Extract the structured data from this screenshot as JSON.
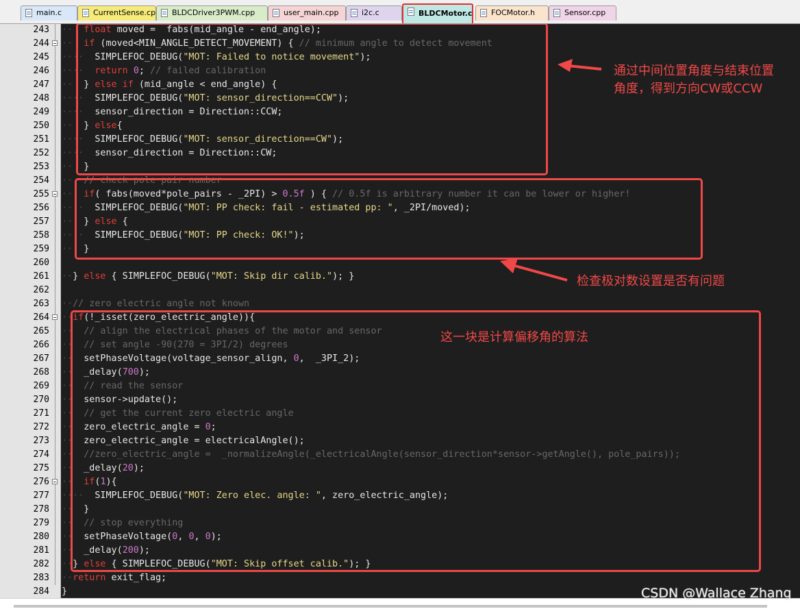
{
  "tabs": [
    {
      "label": "main.c",
      "color": "#d8e8f8",
      "active": false
    },
    {
      "label": "CurrentSense.cpp",
      "color": "#f6eb7a",
      "active": false
    },
    {
      "label": "BLDCDriver3PWM.cpp",
      "color": "#d8ecc8",
      "active": false
    },
    {
      "label": "user_main.cpp",
      "color": "#f4d4d4",
      "active": false
    },
    {
      "label": "i2c.c",
      "color": "#ded4ee",
      "active": false
    },
    {
      "label": "BLDCMotor.cpp",
      "color": "#bfe8e4",
      "active": true
    },
    {
      "label": "FOCMotor.h",
      "color": "#fbe4cc",
      "active": false
    },
    {
      "label": "Sensor.cpp",
      "color": "#f0d4e8",
      "active": false
    }
  ],
  "code_lines": [
    {
      "n": "243",
      "fold": "line",
      "tokens": [
        [
          "ws",
          "··"
        ],
        [
          "sym",
          "  "
        ],
        [
          "kw",
          "float"
        ],
        [
          "sym",
          " moved "
        ],
        [
          "sym",
          "="
        ],
        [
          "sym",
          "  fabs(mid_angle "
        ],
        [
          "sym",
          "-"
        ],
        [
          "sym",
          " end_angle);"
        ]
      ]
    },
    {
      "n": "244",
      "fold": "box",
      "tokens": [
        [
          "ws",
          "··"
        ],
        [
          "sym",
          "  "
        ],
        [
          "kw",
          "if"
        ],
        [
          "sym",
          " (moved<MIN_ANGLE_DETECT_MOVEMENT) { "
        ],
        [
          "cmt",
          "// minimum angle to detect movement"
        ]
      ]
    },
    {
      "n": "245",
      "fold": "line",
      "tokens": [
        [
          "ws",
          "····"
        ],
        [
          "sym",
          "  SIMPLEFOC_DEBUG("
        ],
        [
          "str",
          "\"MOT: Failed to notice movement\""
        ],
        [
          "sym",
          ");"
        ]
      ]
    },
    {
      "n": "246",
      "fold": "line",
      "tokens": [
        [
          "ws",
          "····"
        ],
        [
          "sym",
          "  "
        ],
        [
          "kw",
          "return"
        ],
        [
          "sym",
          " "
        ],
        [
          "num",
          "0"
        ],
        [
          "sym",
          "; "
        ],
        [
          "cmt",
          "// failed calibration"
        ]
      ]
    },
    {
      "n": "247",
      "fold": "line",
      "tokens": [
        [
          "ws",
          "··"
        ],
        [
          "sym",
          "  } "
        ],
        [
          "kw",
          "else if"
        ],
        [
          "sym",
          " (mid_angle < end_angle) {"
        ]
      ]
    },
    {
      "n": "248",
      "fold": "line",
      "tokens": [
        [
          "ws",
          "····"
        ],
        [
          "sym",
          "  SIMPLEFOC_DEBUG("
        ],
        [
          "str",
          "\"MOT: sensor_direction==CCW\""
        ],
        [
          "sym",
          ");"
        ]
      ]
    },
    {
      "n": "249",
      "fold": "line",
      "tokens": [
        [
          "ws",
          "····"
        ],
        [
          "sym",
          "  sensor_direction = Direction::CCW;"
        ]
      ]
    },
    {
      "n": "250",
      "fold": "line",
      "tokens": [
        [
          "ws",
          "··"
        ],
        [
          "sym",
          "  } "
        ],
        [
          "kw",
          "else"
        ],
        [
          "sym",
          "{"
        ]
      ]
    },
    {
      "n": "251",
      "fold": "line",
      "tokens": [
        [
          "ws",
          "····"
        ],
        [
          "sym",
          "  SIMPLEFOC_DEBUG("
        ],
        [
          "str",
          "\"MOT: sensor_direction==CW\""
        ],
        [
          "sym",
          ");"
        ]
      ]
    },
    {
      "n": "252",
      "fold": "line",
      "tokens": [
        [
          "ws",
          "····"
        ],
        [
          "sym",
          "  sensor_direction = Direction::CW;"
        ]
      ]
    },
    {
      "n": "253",
      "fold": "line",
      "tokens": [
        [
          "ws",
          "··"
        ],
        [
          "sym",
          "  }"
        ]
      ]
    },
    {
      "n": "254",
      "fold": "line",
      "tokens": [
        [
          "ws",
          "··"
        ],
        [
          "sym",
          "  "
        ],
        [
          "cmt",
          "// check pole pair number"
        ]
      ]
    },
    {
      "n": "255",
      "fold": "box",
      "tokens": [
        [
          "ws",
          "··"
        ],
        [
          "sym",
          "  "
        ],
        [
          "kw",
          "if"
        ],
        [
          "sym",
          "( fabs(moved*pole_pairs "
        ],
        [
          "sym",
          "-"
        ],
        [
          "sym",
          " _2PI) > "
        ],
        [
          "num",
          "0.5f"
        ],
        [
          "sym",
          " ) { "
        ],
        [
          "cmt",
          "// 0.5f is arbitrary number it can be lower or higher!"
        ]
      ]
    },
    {
      "n": "256",
      "fold": "line",
      "tokens": [
        [
          "ws",
          "····"
        ],
        [
          "sym",
          "  SIMPLEFOC_DEBUG("
        ],
        [
          "str",
          "\"MOT: PP check: fail - estimated pp: \""
        ],
        [
          "sym",
          ", _2PI/moved);"
        ]
      ]
    },
    {
      "n": "257",
      "fold": "line",
      "tokens": [
        [
          "ws",
          "··"
        ],
        [
          "sym",
          "  } "
        ],
        [
          "kw",
          "else"
        ],
        [
          "sym",
          " {"
        ]
      ]
    },
    {
      "n": "258",
      "fold": "line",
      "tokens": [
        [
          "ws",
          "····"
        ],
        [
          "sym",
          "  SIMPLEFOC_DEBUG("
        ],
        [
          "str",
          "\"MOT: PP check: OK!\""
        ],
        [
          "sym",
          ");"
        ]
      ]
    },
    {
      "n": "259",
      "fold": "line",
      "tokens": [
        [
          "ws",
          "··"
        ],
        [
          "sym",
          "  }"
        ]
      ]
    },
    {
      "n": "260",
      "fold": "line",
      "tokens": [
        [
          "ws",
          ""
        ]
      ]
    },
    {
      "n": "261",
      "fold": "line",
      "tokens": [
        [
          "ws",
          "··"
        ],
        [
          "sym",
          "} "
        ],
        [
          "kw",
          "else"
        ],
        [
          "sym",
          " { SIMPLEFOC_DEBUG("
        ],
        [
          "str",
          "\"MOT: Skip dir calib.\""
        ],
        [
          "sym",
          "); }"
        ]
      ]
    },
    {
      "n": "262",
      "fold": "line",
      "tokens": [
        [
          "ws",
          ""
        ]
      ]
    },
    {
      "n": "263",
      "fold": "line",
      "tokens": [
        [
          "ws",
          "··"
        ],
        [
          "cmt",
          "// zero electric angle not known"
        ]
      ]
    },
    {
      "n": "264",
      "fold": "box",
      "tokens": [
        [
          "ws",
          "··"
        ],
        [
          "kw",
          "if"
        ],
        [
          "sym",
          "(!_isset(zero_electric_angle)){"
        ]
      ]
    },
    {
      "n": "265",
      "fold": "line",
      "tokens": [
        [
          "ws",
          "··"
        ],
        [
          "sym",
          "  "
        ],
        [
          "cmt",
          "// align the electrical phases of the motor and sensor"
        ]
      ]
    },
    {
      "n": "266",
      "fold": "line",
      "tokens": [
        [
          "ws",
          "··"
        ],
        [
          "sym",
          "  "
        ],
        [
          "cmt",
          "// set angle -90(270 = 3PI/2) degrees"
        ]
      ]
    },
    {
      "n": "267",
      "fold": "line",
      "tokens": [
        [
          "ws",
          "··"
        ],
        [
          "sym",
          "  setPhaseVoltage(voltage_sensor_align, "
        ],
        [
          "num",
          "0"
        ],
        [
          "sym",
          ",  _3PI_2);"
        ]
      ]
    },
    {
      "n": "268",
      "fold": "line",
      "tokens": [
        [
          "ws",
          "··"
        ],
        [
          "sym",
          "  _delay("
        ],
        [
          "num",
          "700"
        ],
        [
          "sym",
          ");"
        ]
      ]
    },
    {
      "n": "269",
      "fold": "line",
      "tokens": [
        [
          "ws",
          "··"
        ],
        [
          "sym",
          "  "
        ],
        [
          "cmt",
          "// read the sensor"
        ]
      ]
    },
    {
      "n": "270",
      "fold": "line",
      "tokens": [
        [
          "ws",
          "··"
        ],
        [
          "sym",
          "  sensor->update();"
        ]
      ]
    },
    {
      "n": "271",
      "fold": "line",
      "tokens": [
        [
          "ws",
          "··"
        ],
        [
          "sym",
          "  "
        ],
        [
          "cmt",
          "// get the current zero electric angle"
        ]
      ]
    },
    {
      "n": "272",
      "fold": "line",
      "tokens": [
        [
          "ws",
          "··"
        ],
        [
          "sym",
          "  zero_electric_angle = "
        ],
        [
          "num",
          "0"
        ],
        [
          "sym",
          ";"
        ]
      ]
    },
    {
      "n": "273",
      "fold": "line",
      "tokens": [
        [
          "ws",
          "··"
        ],
        [
          "sym",
          "  zero_electric_angle = electricalAngle();"
        ]
      ]
    },
    {
      "n": "274",
      "fold": "line",
      "tokens": [
        [
          "ws",
          "··"
        ],
        [
          "sym",
          "  "
        ],
        [
          "cmt",
          "//zero_electric_angle =  _normalizeAngle(_electricalAngle(sensor_direction*sensor->getAngle(), pole_pairs));"
        ]
      ]
    },
    {
      "n": "275",
      "fold": "line",
      "tokens": [
        [
          "ws",
          "··"
        ],
        [
          "sym",
          "  _delay("
        ],
        [
          "num",
          "20"
        ],
        [
          "sym",
          ");"
        ]
      ]
    },
    {
      "n": "276",
      "fold": "box",
      "tokens": [
        [
          "ws",
          "··"
        ],
        [
          "sym",
          "  "
        ],
        [
          "kw",
          "if"
        ],
        [
          "sym",
          "("
        ],
        [
          "num",
          "1"
        ],
        [
          "sym",
          "){"
        ]
      ]
    },
    {
      "n": "277",
      "fold": "line",
      "tokens": [
        [
          "ws",
          "····"
        ],
        [
          "sym",
          "  SIMPLEFOC_DEBUG("
        ],
        [
          "str",
          "\"MOT: Zero elec. angle: \""
        ],
        [
          "sym",
          ", zero_electric_angle);"
        ]
      ]
    },
    {
      "n": "278",
      "fold": "line",
      "tokens": [
        [
          "ws",
          "··"
        ],
        [
          "sym",
          "  }"
        ]
      ]
    },
    {
      "n": "279",
      "fold": "line",
      "tokens": [
        [
          "ws",
          "··"
        ],
        [
          "sym",
          "  "
        ],
        [
          "cmt",
          "// stop everything"
        ]
      ]
    },
    {
      "n": "280",
      "fold": "line",
      "tokens": [
        [
          "ws",
          "··"
        ],
        [
          "sym",
          "  setPhaseVoltage("
        ],
        [
          "num",
          "0"
        ],
        [
          "sym",
          ", "
        ],
        [
          "num",
          "0"
        ],
        [
          "sym",
          ", "
        ],
        [
          "num",
          "0"
        ],
        [
          "sym",
          ");"
        ]
      ]
    },
    {
      "n": "281",
      "fold": "line",
      "tokens": [
        [
          "ws",
          "··"
        ],
        [
          "sym",
          "  _delay("
        ],
        [
          "num",
          "200"
        ],
        [
          "sym",
          ");"
        ]
      ]
    },
    {
      "n": "282",
      "fold": "line",
      "tokens": [
        [
          "ws",
          "··"
        ],
        [
          "sym",
          "} "
        ],
        [
          "kw",
          "else"
        ],
        [
          "sym",
          " { SIMPLEFOC_DEBUG("
        ],
        [
          "str",
          "\"MOT: Skip offset calib.\""
        ],
        [
          "sym",
          "); }"
        ]
      ]
    },
    {
      "n": "283",
      "fold": "line",
      "tokens": [
        [
          "ws",
          "··"
        ],
        [
          "kw",
          "return"
        ],
        [
          "sym",
          " exit_flag;"
        ]
      ]
    },
    {
      "n": "284",
      "fold": "none",
      "tokens": [
        [
          "sym",
          "}"
        ]
      ]
    }
  ],
  "annotations": {
    "direction_note": "通过中间位置角度与结束位置\n角度，得到方向CW或CCW",
    "pole_pair_note": "检查极对数设置是否有问题",
    "offset_note": "这一块是计算偏移角的算法",
    "color": "#f04848"
  },
  "watermark": "CSDN @Wallace Zhang"
}
